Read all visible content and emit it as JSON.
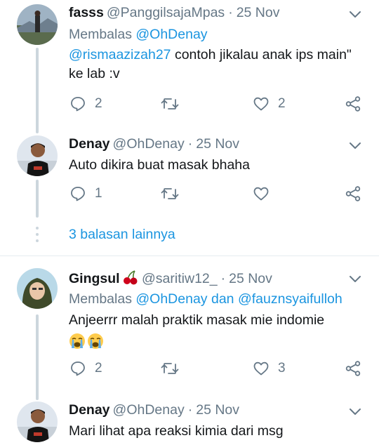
{
  "tweets": [
    {
      "name": "fasss",
      "handle": "@PanggilsajaMpas",
      "dot": "·",
      "date": "25 Nov",
      "reply_prefix": "Membalas",
      "reply_to": "@OhDenay",
      "mention": "@rismaazizah27",
      "text_rest": " contoh jikalau anak ips main\" ke lab :v",
      "replies": "2",
      "retweets": "",
      "likes": "2"
    },
    {
      "name": "Denay",
      "handle": "@OhDenay",
      "dot": "·",
      "date": "25 Nov",
      "text": "Auto dikira buat masak bhaha",
      "replies": "1",
      "retweets": "",
      "likes": ""
    },
    {
      "name": "Gingsul",
      "name_emoji": "🍒",
      "handle": "@saritiw12_",
      "dot": "·",
      "date": "25 Nov",
      "reply_prefix": "Membalas",
      "reply_to_1": "@OhDenay",
      "reply_and": "dan",
      "reply_to_2": "@fauznsyaifulloh",
      "text": "Anjeerrr malah praktik masak mie indomie",
      "emojis": "😭😭",
      "replies": "2",
      "retweets": "",
      "likes": "3"
    },
    {
      "name": "Denay",
      "handle": "@OhDenay",
      "dot": "·",
      "date": "25 Nov",
      "text": "Mari lihat apa reaksi kimia dari msg"
    }
  ],
  "more_replies": "3 balasan lainnya",
  "colors": {
    "link": "#1b95e0",
    "muted": "#657786",
    "thread_line": "#ccd6dd",
    "text": "#14171a"
  },
  "icons": [
    "reply-icon",
    "retweet-icon",
    "like-icon",
    "share-icon",
    "chevron-down-icon",
    "crying-face-icon",
    "cherry-icon"
  ]
}
